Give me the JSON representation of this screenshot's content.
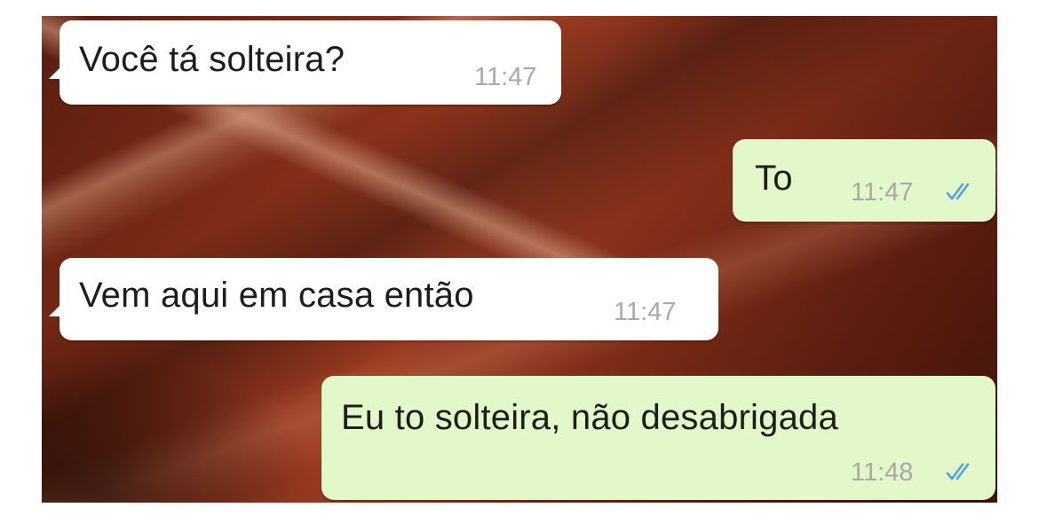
{
  "chat": {
    "messages": [
      {
        "direction": "incoming",
        "text": "Você tá solteira?",
        "time": "11:47"
      },
      {
        "direction": "outgoing",
        "text": "To",
        "time": "11:47",
        "status": "read-double-check-icon"
      },
      {
        "direction": "incoming",
        "text": "Vem aqui em casa então",
        "time": "11:47"
      },
      {
        "direction": "outgoing",
        "text": "Eu to solteira, não desabrigada",
        "time": "11:48",
        "status": "read-double-check-icon"
      }
    ]
  },
  "colors": {
    "incoming_bubble": "#ffffff",
    "outgoing_bubble": "#e2f8c8",
    "read_ticks": "#4fa3e0",
    "wallpaper": "#7a2a16"
  }
}
